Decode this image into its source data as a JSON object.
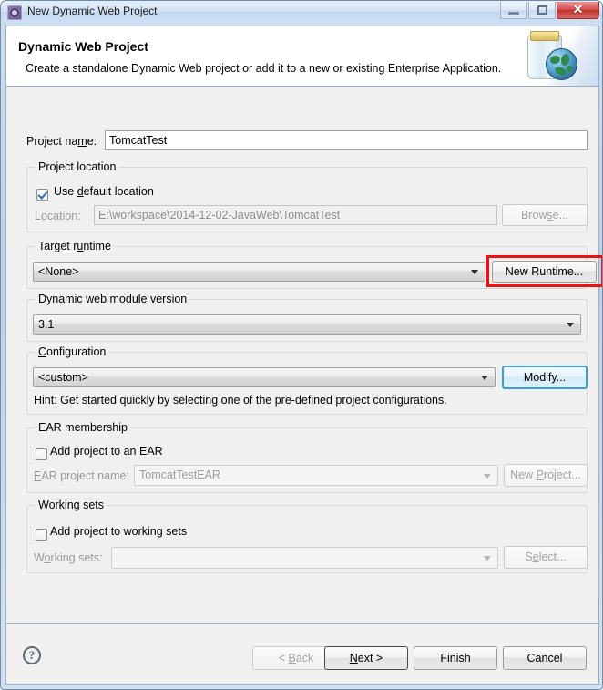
{
  "window": {
    "title": "New Dynamic Web Project",
    "icon": "eclipse-wizard-icon",
    "minimize_label": "",
    "maximize_label": "",
    "close_label": "✕"
  },
  "banner": {
    "title": "Dynamic Web Project",
    "description": "Create a standalone Dynamic Web project or add it to a new or existing Enterprise Application.",
    "art_icon": "jar-with-globe-icon"
  },
  "form": {
    "project_name": {
      "label": "Project na",
      "label_accel": "m",
      "label_tail": "e:",
      "value": "TomcatTest",
      "placeholder": ""
    },
    "project_location": {
      "group_title": "Project location",
      "use_default": {
        "label_head": "Use ",
        "label_accel": "d",
        "label_tail": "efault location",
        "checked": true,
        "enabled": true
      },
      "location": {
        "label_head": "L",
        "label_accel": "o",
        "label_tail": "cation:",
        "value": "E:\\workspace\\2014-12-02-JavaWeb\\TomcatTest",
        "enabled": false
      },
      "browse_button": {
        "label_head": "Brow",
        "label_accel": "s",
        "label_tail": "e...",
        "enabled": false
      }
    },
    "target_runtime": {
      "group_title_head": "Target r",
      "group_title_accel": "u",
      "group_title_tail": "ntime",
      "selected": "<None>",
      "new_runtime_button": "New Runtime...",
      "highlighted": true,
      "highlight_color": "#ee1111"
    },
    "module_version": {
      "group_title_head": "Dynamic web module ",
      "group_title_accel": "v",
      "group_title_tail": "ersion",
      "selected": "3.1"
    },
    "configuration": {
      "group_title_head": "",
      "group_title_accel": "C",
      "group_title_tail": "onfiguration",
      "selected": "<custom>",
      "modify_button": "Modify...",
      "modify_focused": true,
      "hint": "Hint: Get started quickly by selecting one of the pre-defined project configurations."
    },
    "ear_membership": {
      "group_title": "EAR membership",
      "add_to_ear": {
        "label": "Add project to an EAR",
        "checked": false,
        "enabled": true
      },
      "ear_project_name": {
        "label_head": "",
        "label_accel": "E",
        "label_tail": "AR project name:",
        "value": "TomcatTestEAR",
        "enabled": false
      },
      "new_project_button": {
        "label_head": "New ",
        "label_accel": "P",
        "label_tail": "roject...",
        "enabled": false
      }
    },
    "working_sets": {
      "group_title": "Working sets",
      "add_to_working_sets": {
        "label": "Add project to working sets",
        "checked": false,
        "enabled": true
      },
      "working_sets_combo": {
        "label_head": "W",
        "label_accel": "o",
        "label_tail": "rking sets:",
        "value": "",
        "enabled": false
      },
      "select_button": {
        "label_head": "S",
        "label_accel": "e",
        "label_tail": "lect...",
        "enabled": false
      }
    }
  },
  "buttons": {
    "help": "?",
    "back": {
      "head": "< ",
      "accel": "B",
      "tail": "ack",
      "enabled": false
    },
    "next": {
      "head": "",
      "accel": "N",
      "tail": "ext >",
      "enabled": true,
      "default": true
    },
    "finish": {
      "head": "Finish",
      "accel": "",
      "tail": "",
      "enabled": true
    },
    "cancel": {
      "head": "Cancel",
      "accel": "",
      "tail": "",
      "enabled": true
    }
  }
}
